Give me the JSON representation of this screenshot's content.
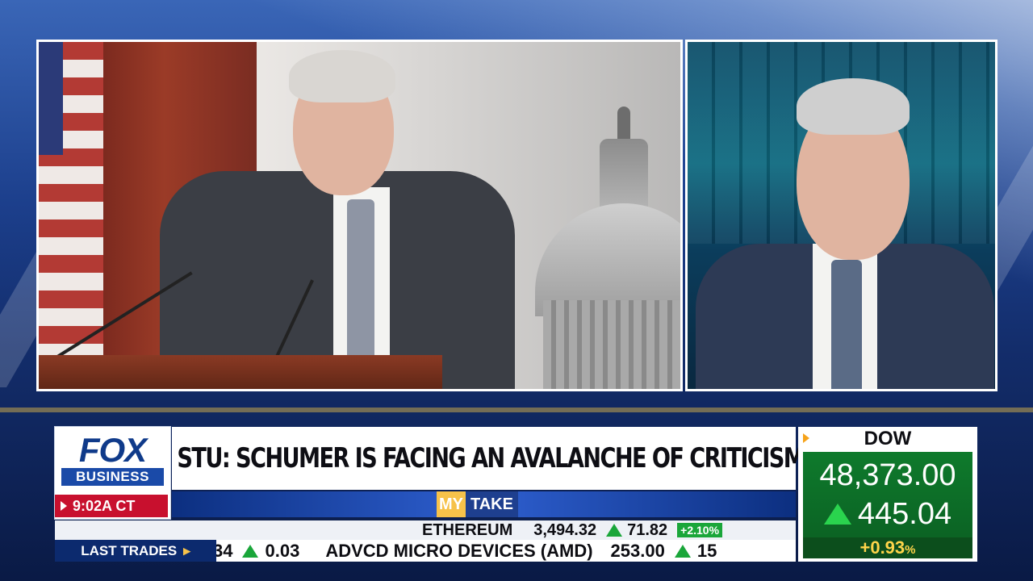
{
  "network": {
    "logo_top": "FOX",
    "logo_bottom": "BUSINESS",
    "clock": "9:02A CT"
  },
  "headline": "STU: SCHUMER IS FACING AN AVALANCHE OF CRITICISM",
  "segment": {
    "my": "MY",
    "take": "TAKE"
  },
  "crypto_ticker": {
    "name": "ETHEREUM",
    "price": "3,494.32",
    "change": "71.82",
    "pct": "+2.10%"
  },
  "trades_ticker": {
    "label": "LAST TRADES",
    "items": [
      {
        "text": "34",
        "change": "0.03"
      },
      {
        "text": "ADVCD MICRO DEVICES (AMD)",
        "price": "253.00",
        "change": "15"
      }
    ]
  },
  "dow": {
    "title": "DOW",
    "value": "48,373.00",
    "change": "445.04",
    "pct": "+0.93",
    "pct_sign": "%"
  },
  "colors": {
    "fox_blue": "#0f3a8a",
    "up_green": "#1aa63a",
    "clock_red": "#c8102e",
    "gold": "#f6c24a"
  }
}
